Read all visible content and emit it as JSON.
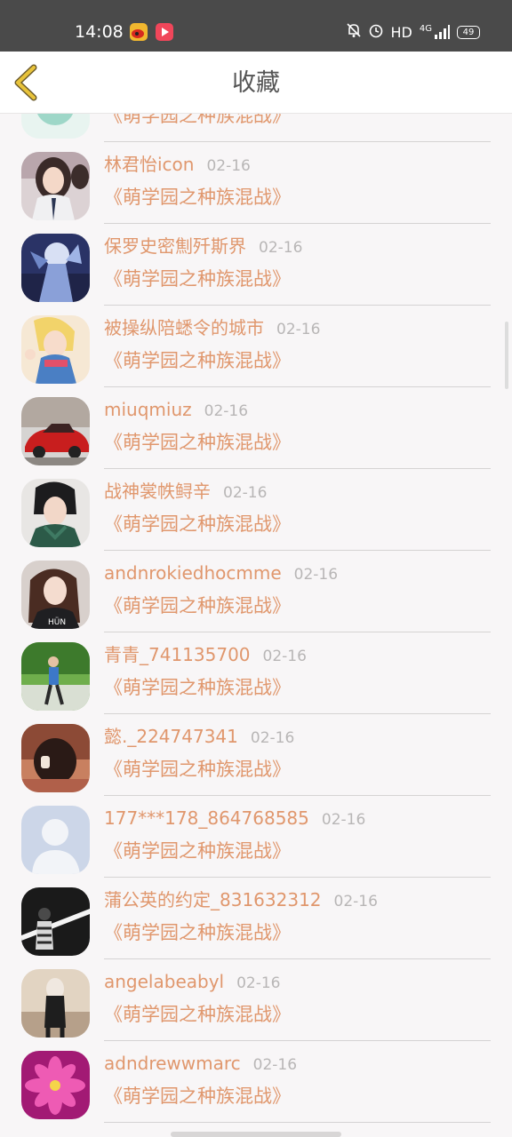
{
  "status_bar": {
    "time": "14:08",
    "hd": "HD",
    "network": "4G",
    "battery": "49",
    "icons": [
      "weibo-icon",
      "video-app-icon",
      "mute-bell-icon",
      "alarm-icon",
      "signal-icon"
    ]
  },
  "header": {
    "title": "收藏",
    "back_icon": "chevron-left-icon"
  },
  "list": [
    {
      "user": "",
      "date": "",
      "book": "《萌学园之种族混战》",
      "avatar": "partial"
    },
    {
      "user": "林君怡icon",
      "date": "02-16",
      "book": "《萌学园之种族混战》",
      "avatar": "photo-girl"
    },
    {
      "user": "保罗史密劁歼斯界",
      "date": "02-16",
      "book": "《萌学园之种族混战》",
      "avatar": "photo-fantasy"
    },
    {
      "user": "被操纵陪蟋令的城市",
      "date": "02-16",
      "book": "《萌学园之种族混战》",
      "avatar": "photo-anime"
    },
    {
      "user": "miuqmiuz",
      "date": "02-16",
      "book": "《萌学园之种族混战》",
      "avatar": "photo-car"
    },
    {
      "user": "战神裳帙鲟辛",
      "date": "02-16",
      "book": "《萌学园之种族混战》",
      "avatar": "photo-boy"
    },
    {
      "user": "andnrokiedhocmme",
      "date": "02-16",
      "book": "《萌学园之种族混战》",
      "avatar": "photo-woman"
    },
    {
      "user": "青青_741135700",
      "date": "02-16",
      "book": "《萌学园之种族混战》",
      "avatar": "photo-park"
    },
    {
      "user": "懿._224747341",
      "date": "02-16",
      "book": "《萌学园之种族混战》",
      "avatar": "photo-hair"
    },
    {
      "user": "177***178_864768585",
      "date": "02-16",
      "book": "《萌学园之种族混战》",
      "avatar": "default"
    },
    {
      "user": "蒲公英的约定_831632312",
      "date": "02-16",
      "book": "《萌学园之种族混战》",
      "avatar": "photo-dark"
    },
    {
      "user": "angelabeabyl",
      "date": "02-16",
      "book": "《萌学园之种族混战》",
      "avatar": "photo-figure"
    },
    {
      "user": "adndrewwmarc",
      "date": "02-16",
      "book": "《萌学园之种族混战》",
      "avatar": "photo-flower"
    }
  ],
  "colors": {
    "accent": "#e0976d",
    "date": "#b8b6b6",
    "back_arrow": "#e8c33a"
  }
}
